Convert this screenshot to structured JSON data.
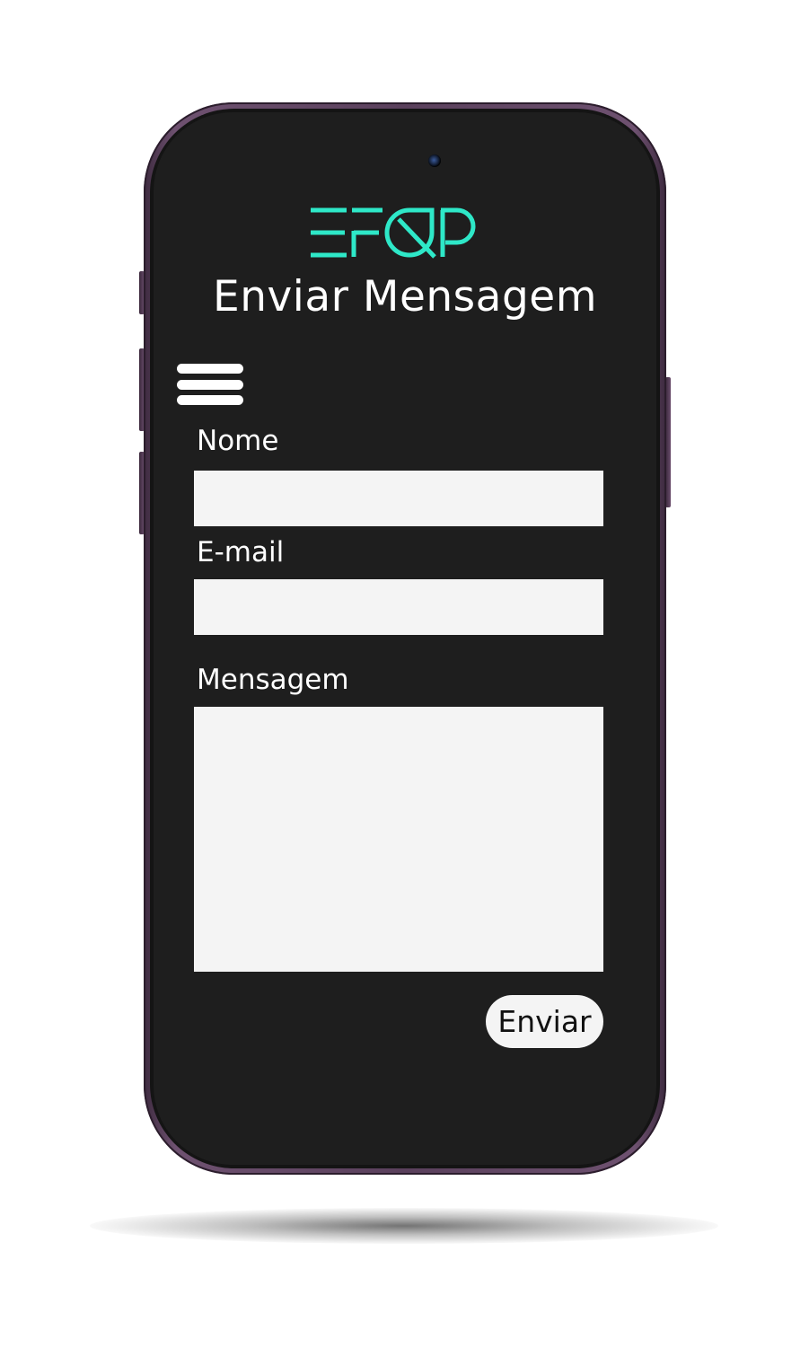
{
  "app": {
    "logo_text": "EFQP",
    "title": "Enviar Mensagem",
    "accent_color": "#2ee8c8",
    "screen_background": "#1e1e1e",
    "frame_color": "#5a405c"
  },
  "menu": {
    "icon": "hamburger-menu-icon"
  },
  "form": {
    "name_label": "Nome",
    "name_value": "",
    "email_label": "E-mail",
    "email_value": "",
    "message_label": "Mensagem",
    "message_value": "",
    "submit_label": "Enviar"
  }
}
